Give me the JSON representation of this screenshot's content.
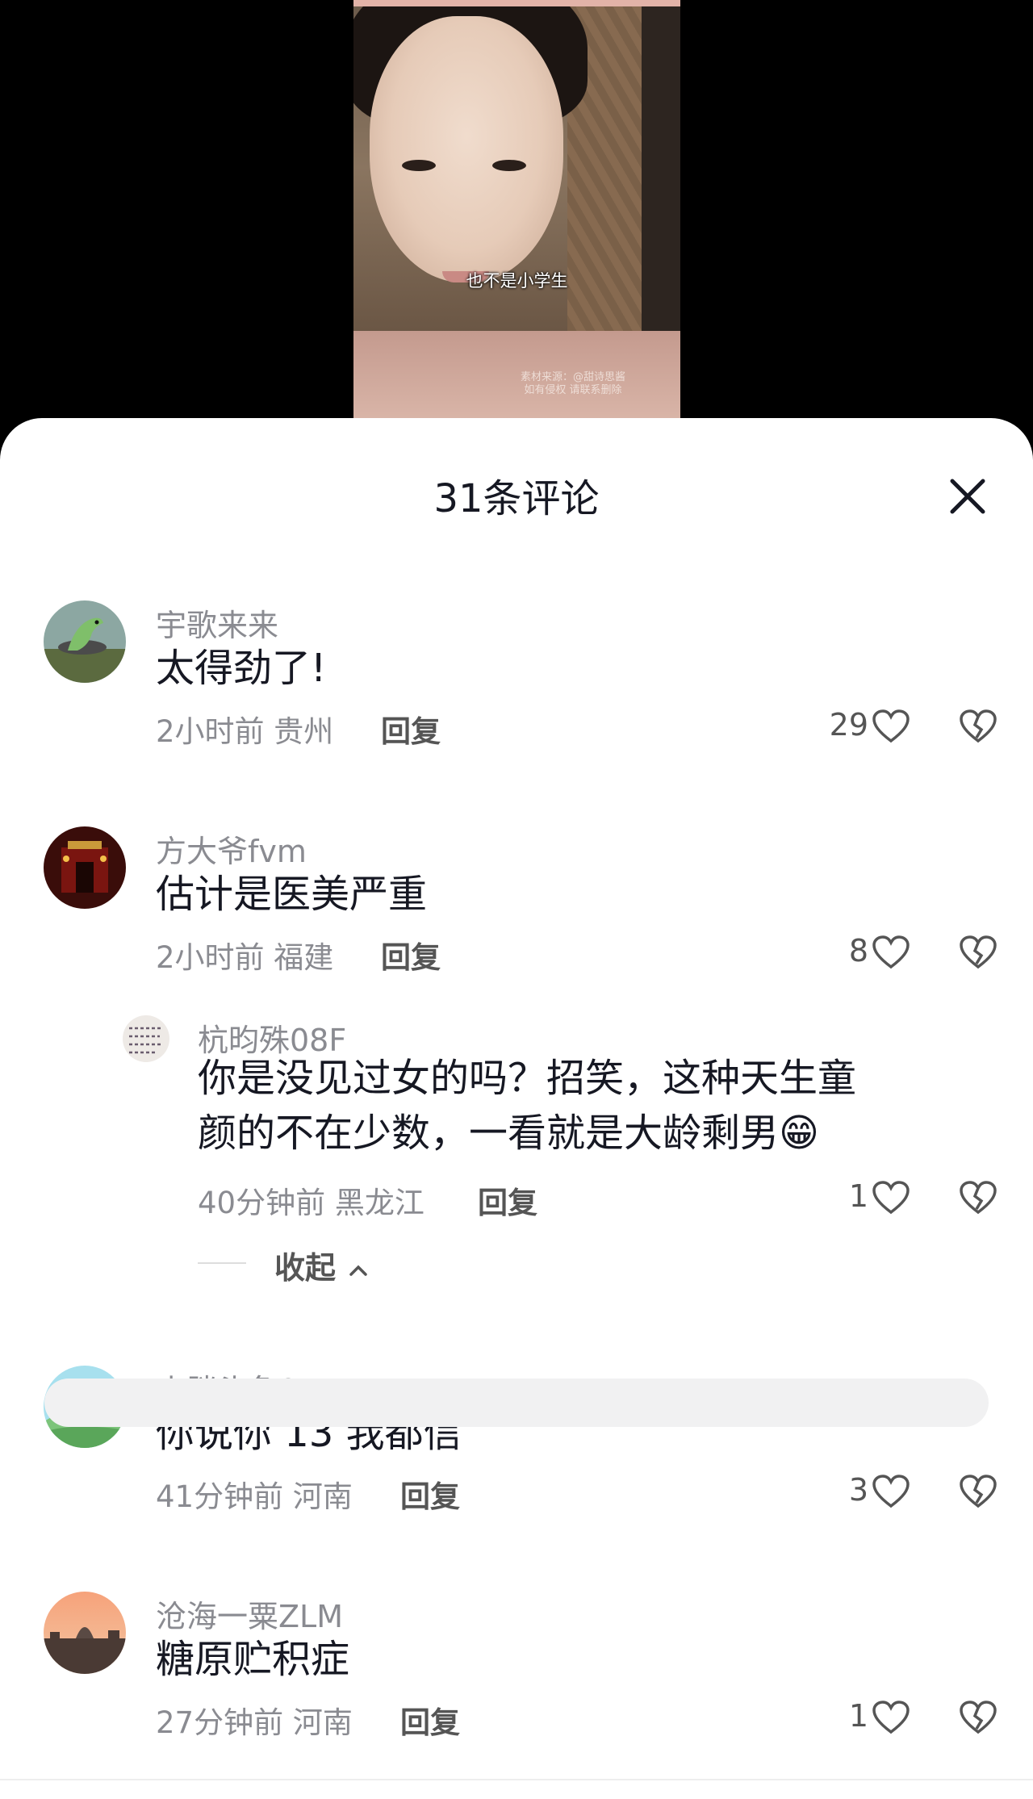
{
  "video": {
    "subtitle": "也不是小学生",
    "watermark_line1": "素材来源：@甜诗思酱",
    "watermark_line2": "如有侵权 请联系删除"
  },
  "sheet": {
    "title": "31条评论",
    "close_icon": "close-icon"
  },
  "comments": [
    {
      "user": "宇歌来来",
      "text": "太得劲了!",
      "time": "2小时前 贵州",
      "reply_label": "回复",
      "likes": "29"
    },
    {
      "user": "方大爷fvm",
      "text": "估计是医美严重",
      "time": "2小时前 福建",
      "reply_label": "回复",
      "likes": "8"
    },
    {
      "user": "杭昀殊08F",
      "text_line1": "你是没见过女的吗？招笑，这种天生童",
      "text_line2": "颜的不在少数，一看就是大龄剩男😁",
      "time": "40分钟前 黑龙江",
      "reply_label": "回复",
      "likes": "1"
    },
    {
      "user": "小胖头鱼0",
      "text": "你说你 13 我都信",
      "time": "41分钟前 河南",
      "reply_label": "回复",
      "likes": "3"
    },
    {
      "user": "沧海一粟ZLM",
      "text": "糖原贮积症",
      "time": "27分钟前 河南",
      "reply_label": "回复",
      "likes": "1"
    }
  ],
  "collapse_label": "收起",
  "colors": {
    "text": "#161823",
    "muted": "#8a8b91",
    "sheet": "#ffffff"
  }
}
